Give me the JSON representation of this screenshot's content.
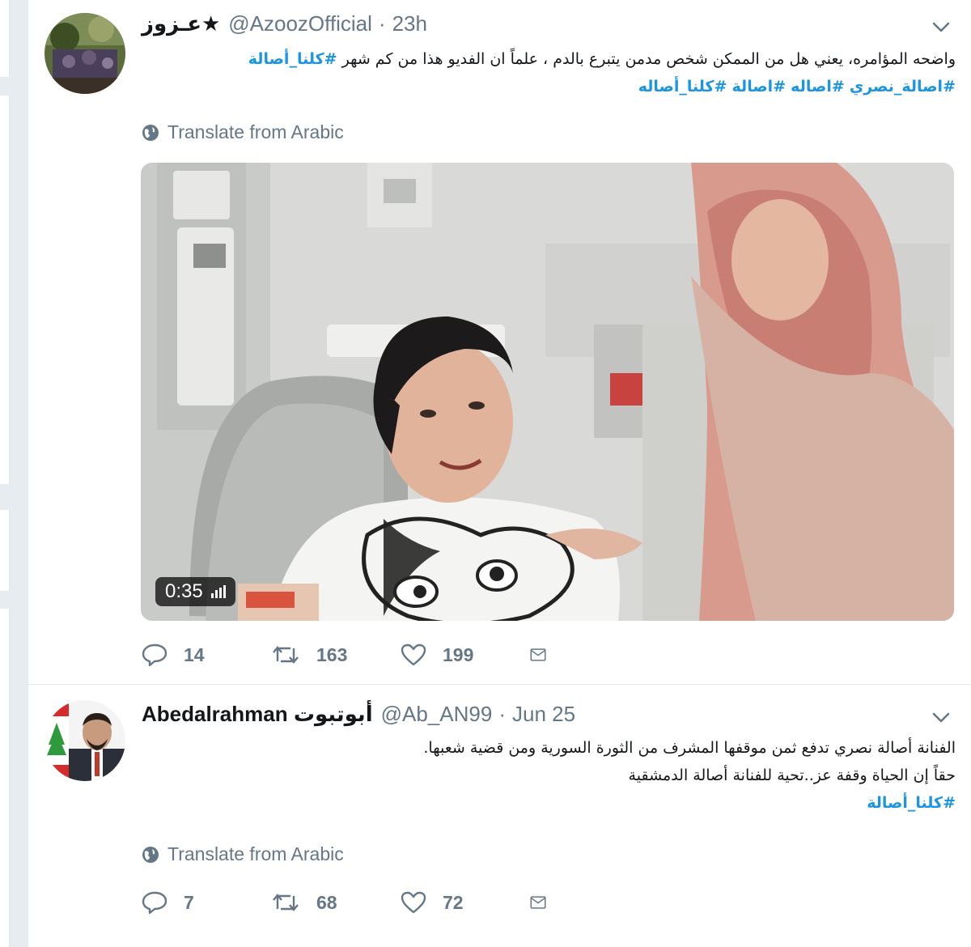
{
  "tweets": [
    {
      "fullname": "عـزوز★",
      "username": "@AzoozOfficial",
      "separator": "·",
      "time": "23h",
      "text_line1": "واضحه المؤامره، يعني هل من الممكن شخص مدمن يتبرع بالدم ، علماً ان الفديو هذا من كم شهر",
      "text_line1_tag": "#كلنا_أصالة",
      "hashtags_line2": [
        "#اصالة_نصري",
        "#اصاله",
        "#اصالة",
        "#كلنا_أصاله"
      ],
      "translate_label": "Translate from Arabic",
      "video_duration": "0:35",
      "replies": "14",
      "retweets": "163",
      "likes": "199"
    },
    {
      "fullname": "Abedalrahman أبوتبوت",
      "username": "@Ab_AN99",
      "separator": "·",
      "time": "Jun 25",
      "text_line1": "الفنانة أصالة نصري تدفع ثمن موقفها المشرف من الثورة السورية ومن قضية شعبها.",
      "text_line2": "حقاً إن الحياة وقفة عز..تحية للفنانة أصالة الدمشقية",
      "text_line3": "#كلنا_أصالة",
      "translate_label": "Translate from Arabic",
      "replies": "7",
      "retweets": "68",
      "likes": "72"
    }
  ],
  "colors": {
    "link": "#1b95e0",
    "muted": "#657786",
    "border": "#e1e8ed",
    "background": "#e6ecf0"
  },
  "icons": [
    "chevron-down-icon",
    "globe-icon",
    "reply-icon",
    "retweet-icon",
    "like-icon",
    "direct-message-icon"
  ]
}
